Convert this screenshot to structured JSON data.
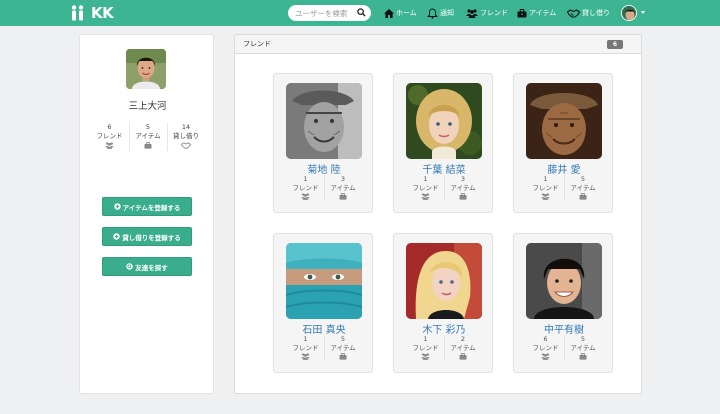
{
  "app": {
    "logo": "KK"
  },
  "search": {
    "placeholder": "ユーザーを検索"
  },
  "nav": {
    "home": "ホーム",
    "notify": "通知",
    "friends": "フレンド",
    "items": "アイテム",
    "lending": "貸し借り"
  },
  "profile": {
    "name": "三上大河",
    "stats": [
      {
        "count": "6",
        "label": "フレンド",
        "icon": "users-icon"
      },
      {
        "count": "5",
        "label": "アイテム",
        "icon": "briefcase-icon"
      },
      {
        "count": "14",
        "label": "貸し借り",
        "icon": "handshake-icon"
      }
    ],
    "actions": [
      {
        "label": "アイテムを登録する",
        "icon": "plus-circle-icon"
      },
      {
        "label": "貸し借りを登録する",
        "icon": "plus-circle-icon"
      },
      {
        "label": "友達を探す",
        "icon": "search-icon"
      }
    ]
  },
  "friends_panel": {
    "title": "フレンド",
    "count": "6",
    "friends": [
      {
        "name": "菊地 陸",
        "friends": "1",
        "items": "3",
        "friends_label": "フレンド",
        "items_label": "アイテム"
      },
      {
        "name": "千葉 結菜",
        "friends": "1",
        "items": "3",
        "friends_label": "フレンド",
        "items_label": "アイテム"
      },
      {
        "name": "藤井 愛",
        "friends": "1",
        "items": "5",
        "friends_label": "フレンド",
        "items_label": "アイテム"
      },
      {
        "name": "石田 真央",
        "friends": "1",
        "items": "5",
        "friends_label": "フレンド",
        "items_label": "アイテム"
      },
      {
        "name": "木下 彩乃",
        "friends": "1",
        "items": "2",
        "friends_label": "フレンド",
        "items_label": "アイテム"
      },
      {
        "name": "中平有樹",
        "friends": "6",
        "items": "5",
        "friends_label": "フレンド",
        "items_label": "アイテム"
      }
    ]
  },
  "colors": {
    "brand": "#3db593",
    "button": "#3aae8c",
    "link": "#337ab7",
    "badge": "#777777"
  }
}
